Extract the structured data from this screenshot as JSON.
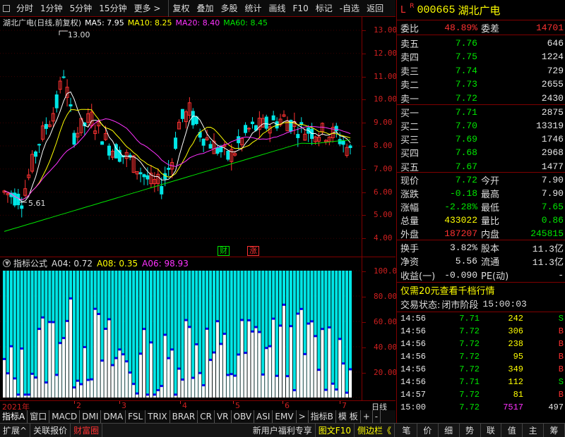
{
  "toolbar": {
    "items": [
      "分时",
      "1分钟",
      "5分钟",
      "15分钟",
      "更多 >",
      "复权",
      "叠加",
      "多股",
      "统计",
      "画线",
      "F10",
      "标记",
      "-自选",
      "返回"
    ]
  },
  "main_header": {
    "title": "湖北广电(日线,前复权)",
    "ma5": "MA5: 7.95",
    "ma10": "MA10: 8.25",
    "ma20": "MA20: 8.40",
    "ma60": "MA60: 8.45"
  },
  "main_annot": {
    "high": "13.00",
    "low": "5.61",
    "tag1": "财",
    "tag2": "涨"
  },
  "y_ticks_main": [
    "13.00",
    "12.00",
    "11.00",
    "10.00",
    "9.00",
    "8.00",
    "7.00",
    "6.00",
    "5.00",
    "4.00"
  ],
  "ind_header": {
    "title": "指标公式",
    "a04": "A04: 0.72",
    "a08": "A08: 0.35",
    "a06": "A06: 98.93"
  },
  "y_ticks_ind": [
    "100.0",
    "80.00",
    "60.00",
    "40.00",
    "20.00"
  ],
  "date_axis": {
    "year": "2021年",
    "months": [
      "2",
      "3",
      "4",
      "5",
      "6",
      "7"
    ],
    "right_label": "日线"
  },
  "tabs": [
    "指标A",
    "窗口",
    "MACD",
    "DMI",
    "DMA",
    "FSL",
    "TRIX",
    "BRAR",
    "CR",
    "VR",
    "OBV",
    "ASI",
    "EMV",
    ">",
    "指标B",
    "模 板",
    "+",
    "-"
  ],
  "bottom_bar": {
    "items": [
      "扩展^",
      "关联报价",
      "财富圈"
    ],
    "news": "新用户福利专享",
    "f10": "图文F10",
    "side": "侧边栏《",
    "right_tabs": [
      "笔",
      "价",
      "细",
      "势",
      "联",
      "值",
      "主",
      "筹"
    ]
  },
  "quote": {
    "flag": "L",
    "r": "R",
    "code": "000665",
    "name": "湖北广电",
    "weibi_label": "委比",
    "weibi": "48.89%",
    "weicha_label": "委差",
    "weicha": "14701",
    "asks": [
      {
        "label": "卖五",
        "price": "7.76",
        "vol": "646"
      },
      {
        "label": "卖四",
        "price": "7.75",
        "vol": "1224"
      },
      {
        "label": "卖三",
        "price": "7.74",
        "vol": "729"
      },
      {
        "label": "卖二",
        "price": "7.73",
        "vol": "2655"
      },
      {
        "label": "卖一",
        "price": "7.72",
        "vol": "2430"
      }
    ],
    "bids": [
      {
        "label": "买一",
        "price": "7.71",
        "vol": "2875"
      },
      {
        "label": "买二",
        "price": "7.70",
        "vol": "13319"
      },
      {
        "label": "买三",
        "price": "7.69",
        "vol": "1746"
      },
      {
        "label": "买四",
        "price": "7.68",
        "vol": "2968"
      },
      {
        "label": "买五",
        "price": "7.67",
        "vol": "1477"
      }
    ],
    "stats": [
      {
        "l1": "现价",
        "v1": "7.72",
        "c1": "grn",
        "l2": "今开",
        "v2": "7.90",
        "c2": "wht"
      },
      {
        "l1": "涨跌",
        "v1": "-0.18",
        "c1": "grn",
        "l2": "最高",
        "v2": "7.90",
        "c2": "wht"
      },
      {
        "l1": "涨幅",
        "v1": "-2.28%",
        "c1": "grn",
        "l2": "最低",
        "v2": "7.65",
        "c2": "grn"
      },
      {
        "l1": "总量",
        "v1": "433022",
        "c1": "yel",
        "l2": "量比",
        "v2": "0.86",
        "c2": "grn"
      },
      {
        "l1": "外盘",
        "v1": "187207",
        "c1": "red",
        "l2": "内盘",
        "v2": "245815",
        "c2": "grn"
      }
    ],
    "stats2": [
      {
        "l1": "换手",
        "v1": "3.82%",
        "l2": "股本",
        "v2": "11.3亿"
      },
      {
        "l1": "净资",
        "v1": "5.56",
        "l2": "流通",
        "v2": "11.3亿"
      },
      {
        "l1": "收益(一)",
        "v1": "-0.090",
        "l2": "PE(动)",
        "v2": "-"
      }
    ],
    "promo": "仅需20元查看千档行情",
    "status_label": "交易状态:",
    "status": "闭市阶段",
    "status_time": "15:00:03",
    "ticks": [
      {
        "t": "14:56",
        "p": "7.71",
        "v": "242",
        "s": "S"
      },
      {
        "t": "14:56",
        "p": "7.72",
        "v": "306",
        "s": "B"
      },
      {
        "t": "14:56",
        "p": "7.72",
        "v": "238",
        "s": "B"
      },
      {
        "t": "14:56",
        "p": "7.72",
        "v": "95",
        "s": "B"
      },
      {
        "t": "14:56",
        "p": "7.72",
        "v": "349",
        "s": "B"
      },
      {
        "t": "14:56",
        "p": "7.71",
        "v": "112",
        "s": "S"
      },
      {
        "t": "14:57",
        "p": "7.72",
        "v": "81",
        "s": "B"
      },
      {
        "t": "15:00",
        "p": "7.72",
        "v": "7517",
        "s": "497"
      }
    ]
  },
  "colors": {
    "up": "#ff3232",
    "down": "#00e6e6",
    "ma5": "#ffffff",
    "ma10": "#ffff00",
    "ma20": "#ff32ff",
    "ma60": "#00e600",
    "grid": "#800000"
  }
}
